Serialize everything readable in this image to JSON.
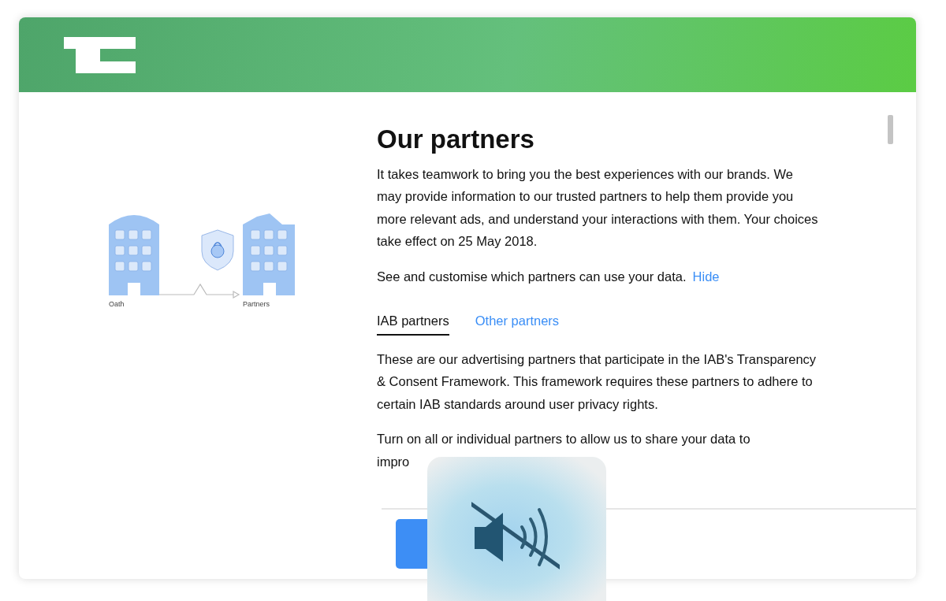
{
  "illustration": {
    "left_label": "Oath",
    "right_label": "Partners"
  },
  "title": "Our partners",
  "intro": "It takes teamwork to bring you the best experiences with our brands. We may provide information to our trusted partners to help them provide you more relevant ads, and understand your interactions with them. Your choices take effect on 25 May 2018.",
  "customise": {
    "text": "See and customise which partners can use your data.",
    "link": "Hide"
  },
  "tabs": [
    {
      "label": "IAB partners",
      "selected": true
    },
    {
      "label": "Other partners",
      "selected": false
    }
  ],
  "description": "These are our advertising partners that participate in the IAB's Transparency & Consent Framework. This framework requires these partners to adhere to certain IAB standards around user privacy rights.",
  "instruction": "Turn on all or individual partners to allow us to share your data to impro",
  "overlay": {
    "kind": "mute"
  }
}
